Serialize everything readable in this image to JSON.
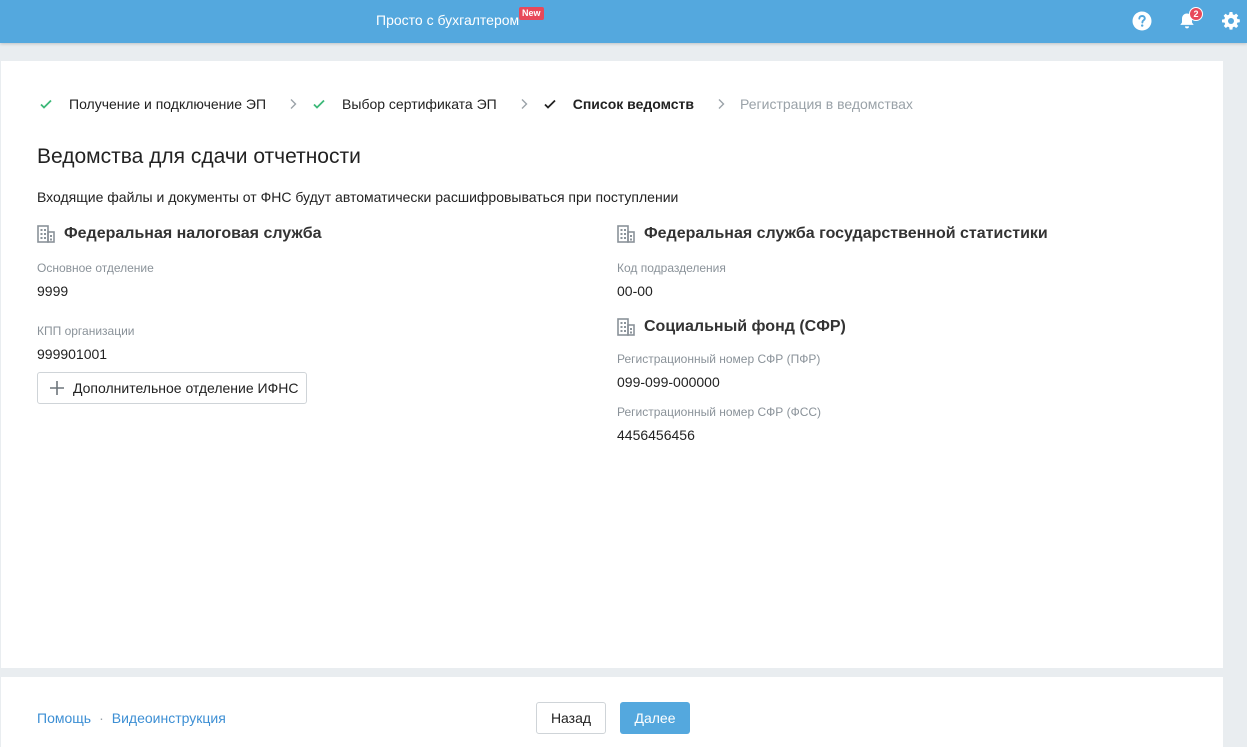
{
  "header": {
    "app_title": "Просто с бухгалтером",
    "new_badge": "New",
    "notifications_count": "2",
    "icons": [
      "help-icon",
      "bell-icon",
      "gear-icon"
    ]
  },
  "stepper": {
    "steps": [
      {
        "label": "Получение и подключение ЭП",
        "state": "done"
      },
      {
        "label": "Выбор сертификата ЭП",
        "state": "done"
      },
      {
        "label": "Список ведомств",
        "state": "current"
      },
      {
        "label": "Регистрация в ведомствах",
        "state": "todo"
      }
    ]
  },
  "main": {
    "title": "Ведомства для сдачи отчетности",
    "subtitle": "Входящие файлы и документы от ФНС будут автоматически расшифровываться при поступлении",
    "fns": {
      "name": "Федеральная налоговая служба",
      "main_branch_label": "Основное отделение",
      "main_branch_value": "9999",
      "kpp_label": "КПП организации",
      "kpp_value": "999901001",
      "add_button": "Дополнительное отделение ИФНС"
    },
    "rosstat": {
      "name": "Федеральная служба государственной статистики",
      "code_label": "Код подразделения",
      "code_value": "00-00"
    },
    "sfr": {
      "name": "Социальный фонд (СФР)",
      "pfr_label": "Регистрационный номер СФР (ПФР)",
      "pfr_value": "099-099-000000",
      "fss_label": "Регистрационный номер СФР (ФСС)",
      "fss_value": "4456456456"
    }
  },
  "footer": {
    "help_link": "Помощь",
    "separator": "·",
    "video_link": "Видеоинструкция",
    "back_button": "Назад",
    "next_button": "Далее"
  },
  "colors": {
    "accent": "#54a8de",
    "badge": "#e8495a",
    "check": "#3cb878",
    "link": "#3d8fd4"
  }
}
